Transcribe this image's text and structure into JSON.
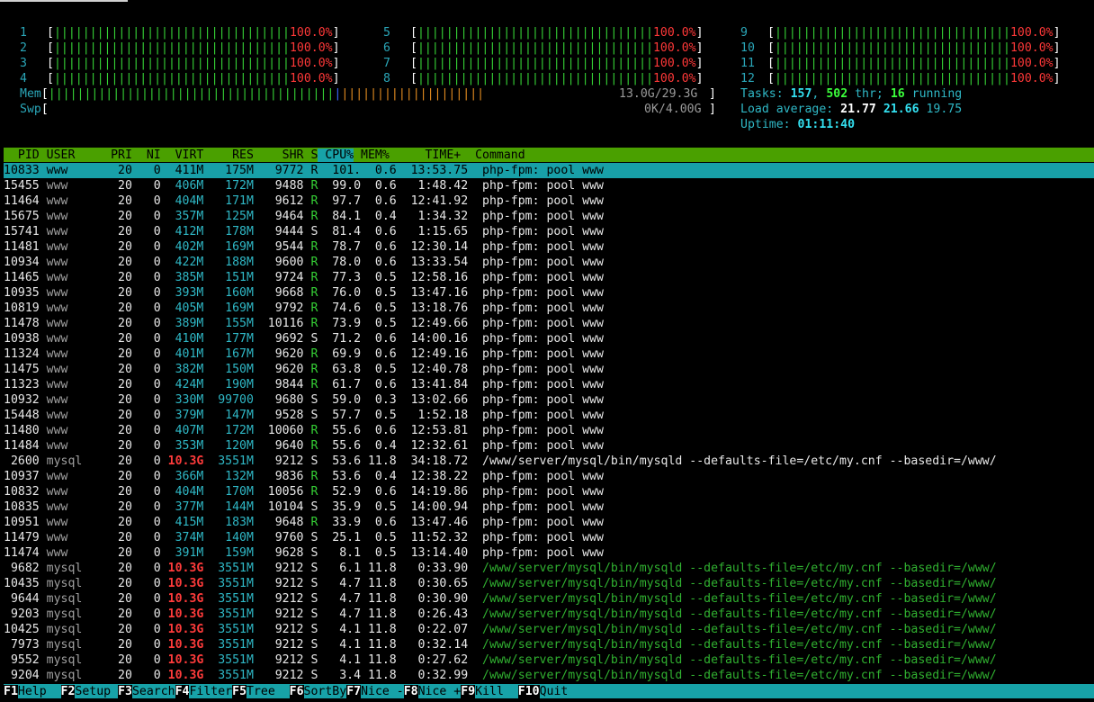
{
  "cpus": [
    {
      "id": "1",
      "pct": "100.0%"
    },
    {
      "id": "2",
      "pct": "100.0%"
    },
    {
      "id": "3",
      "pct": "100.0%"
    },
    {
      "id": "4",
      "pct": "100.0%"
    },
    {
      "id": "5",
      "pct": "100.0%"
    },
    {
      "id": "6",
      "pct": "100.0%"
    },
    {
      "id": "7",
      "pct": "100.0%"
    },
    {
      "id": "8",
      "pct": "100.0%"
    },
    {
      "id": "9",
      "pct": "100.0%"
    },
    {
      "id": "10",
      "pct": "100.0%"
    },
    {
      "id": "11",
      "pct": "100.0%"
    },
    {
      "id": "12",
      "pct": "100.0%"
    }
  ],
  "mem": {
    "label": "Mem",
    "value": "13.0G/29.3G"
  },
  "swp": {
    "label": "Swp",
    "value": "0K/4.00G"
  },
  "tasks": {
    "label": "Tasks:",
    "count": "157",
    "threads": "502",
    "thr_label": "thr;",
    "running": "16",
    "running_label": "running"
  },
  "load": {
    "label": "Load average:",
    "l1": "21.77",
    "l5": "21.66",
    "l15": "19.75"
  },
  "uptime": {
    "label": "Uptime:",
    "value": "01:11:40"
  },
  "columns": [
    "PID",
    "USER",
    "PRI",
    "NI",
    "VIRT",
    "RES",
    "SHR",
    "S",
    "CPU%",
    "MEM%",
    "TIME+",
    "Command"
  ],
  "processes": [
    {
      "pid": "10833",
      "user": "www",
      "pri": "20",
      "ni": "0",
      "virt": "411M",
      "res": "175M",
      "shr": "9772",
      "s": "R",
      "cpu": "101.",
      "mem": "0.6",
      "time": "13:53.75",
      "cmd": "php-fpm: pool www"
    },
    {
      "pid": "15455",
      "user": "www",
      "pri": "20",
      "ni": "0",
      "virt": "406M",
      "res": "172M",
      "shr": "9488",
      "s": "R",
      "cpu": "99.0",
      "mem": "0.6",
      "time": "1:48.42",
      "cmd": "php-fpm: pool www"
    },
    {
      "pid": "11464",
      "user": "www",
      "pri": "20",
      "ni": "0",
      "virt": "404M",
      "res": "171M",
      "shr": "9612",
      "s": "R",
      "cpu": "97.7",
      "mem": "0.6",
      "time": "12:41.92",
      "cmd": "php-fpm: pool www"
    },
    {
      "pid": "15675",
      "user": "www",
      "pri": "20",
      "ni": "0",
      "virt": "357M",
      "res": "125M",
      "shr": "9464",
      "s": "R",
      "cpu": "84.1",
      "mem": "0.4",
      "time": "1:34.32",
      "cmd": "php-fpm: pool www"
    },
    {
      "pid": "15741",
      "user": "www",
      "pri": "20",
      "ni": "0",
      "virt": "412M",
      "res": "178M",
      "shr": "9444",
      "s": "S",
      "cpu": "81.4",
      "mem": "0.6",
      "time": "1:15.65",
      "cmd": "php-fpm: pool www"
    },
    {
      "pid": "11481",
      "user": "www",
      "pri": "20",
      "ni": "0",
      "virt": "402M",
      "res": "169M",
      "shr": "9544",
      "s": "R",
      "cpu": "78.7",
      "mem": "0.6",
      "time": "12:30.14",
      "cmd": "php-fpm: pool www"
    },
    {
      "pid": "10934",
      "user": "www",
      "pri": "20",
      "ni": "0",
      "virt": "422M",
      "res": "188M",
      "shr": "9600",
      "s": "R",
      "cpu": "78.0",
      "mem": "0.6",
      "time": "13:33.54",
      "cmd": "php-fpm: pool www"
    },
    {
      "pid": "11465",
      "user": "www",
      "pri": "20",
      "ni": "0",
      "virt": "385M",
      "res": "151M",
      "shr": "9724",
      "s": "R",
      "cpu": "77.3",
      "mem": "0.5",
      "time": "12:58.16",
      "cmd": "php-fpm: pool www"
    },
    {
      "pid": "10935",
      "user": "www",
      "pri": "20",
      "ni": "0",
      "virt": "393M",
      "res": "160M",
      "shr": "9668",
      "s": "R",
      "cpu": "76.0",
      "mem": "0.5",
      "time": "13:47.16",
      "cmd": "php-fpm: pool www"
    },
    {
      "pid": "10819",
      "user": "www",
      "pri": "20",
      "ni": "0",
      "virt": "405M",
      "res": "169M",
      "shr": "9792",
      "s": "R",
      "cpu": "74.6",
      "mem": "0.5",
      "time": "13:18.76",
      "cmd": "php-fpm: pool www"
    },
    {
      "pid": "11478",
      "user": "www",
      "pri": "20",
      "ni": "0",
      "virt": "389M",
      "res": "155M",
      "shr": "10116",
      "s": "R",
      "cpu": "73.9",
      "mem": "0.5",
      "time": "12:49.66",
      "cmd": "php-fpm: pool www"
    },
    {
      "pid": "10938",
      "user": "www",
      "pri": "20",
      "ni": "0",
      "virt": "410M",
      "res": "177M",
      "shr": "9692",
      "s": "S",
      "cpu": "71.2",
      "mem": "0.6",
      "time": "14:00.16",
      "cmd": "php-fpm: pool www"
    },
    {
      "pid": "11324",
      "user": "www",
      "pri": "20",
      "ni": "0",
      "virt": "401M",
      "res": "167M",
      "shr": "9620",
      "s": "R",
      "cpu": "69.9",
      "mem": "0.6",
      "time": "12:49.16",
      "cmd": "php-fpm: pool www"
    },
    {
      "pid": "11475",
      "user": "www",
      "pri": "20",
      "ni": "0",
      "virt": "382M",
      "res": "150M",
      "shr": "9620",
      "s": "R",
      "cpu": "63.8",
      "mem": "0.5",
      "time": "12:40.78",
      "cmd": "php-fpm: pool www"
    },
    {
      "pid": "11323",
      "user": "www",
      "pri": "20",
      "ni": "0",
      "virt": "424M",
      "res": "190M",
      "shr": "9844",
      "s": "R",
      "cpu": "61.7",
      "mem": "0.6",
      "time": "13:41.84",
      "cmd": "php-fpm: pool www"
    },
    {
      "pid": "10932",
      "user": "www",
      "pri": "20",
      "ni": "0",
      "virt": "330M",
      "res": "99700",
      "shr": "9680",
      "s": "S",
      "cpu": "59.0",
      "mem": "0.3",
      "time": "13:02.66",
      "cmd": "php-fpm: pool www"
    },
    {
      "pid": "15448",
      "user": "www",
      "pri": "20",
      "ni": "0",
      "virt": "379M",
      "res": "147M",
      "shr": "9528",
      "s": "S",
      "cpu": "57.7",
      "mem": "0.5",
      "time": "1:52.18",
      "cmd": "php-fpm: pool www"
    },
    {
      "pid": "11480",
      "user": "www",
      "pri": "20",
      "ni": "0",
      "virt": "407M",
      "res": "172M",
      "shr": "10060",
      "s": "R",
      "cpu": "55.6",
      "mem": "0.6",
      "time": "12:53.81",
      "cmd": "php-fpm: pool www"
    },
    {
      "pid": "11484",
      "user": "www",
      "pri": "20",
      "ni": "0",
      "virt": "353M",
      "res": "120M",
      "shr": "9640",
      "s": "R",
      "cpu": "55.6",
      "mem": "0.4",
      "time": "12:32.61",
      "cmd": "php-fpm: pool www"
    },
    {
      "pid": "2600",
      "user": "mysql",
      "pri": "20",
      "ni": "0",
      "virt": "10.3G",
      "res": "3551M",
      "shr": "9212",
      "s": "S",
      "cpu": "53.6",
      "mem": "11.8",
      "time": "34:18.72",
      "cmd": "/www/server/mysql/bin/mysqld --defaults-file=/etc/my.cnf --basedir=/www/"
    },
    {
      "pid": "10937",
      "user": "www",
      "pri": "20",
      "ni": "0",
      "virt": "366M",
      "res": "132M",
      "shr": "9836",
      "s": "R",
      "cpu": "53.6",
      "mem": "0.4",
      "time": "12:38.22",
      "cmd": "php-fpm: pool www"
    },
    {
      "pid": "10832",
      "user": "www",
      "pri": "20",
      "ni": "0",
      "virt": "404M",
      "res": "170M",
      "shr": "10056",
      "s": "R",
      "cpu": "52.9",
      "mem": "0.6",
      "time": "14:19.86",
      "cmd": "php-fpm: pool www"
    },
    {
      "pid": "10835",
      "user": "www",
      "pri": "20",
      "ni": "0",
      "virt": "377M",
      "res": "144M",
      "shr": "10104",
      "s": "S",
      "cpu": "35.9",
      "mem": "0.5",
      "time": "14:00.94",
      "cmd": "php-fpm: pool www"
    },
    {
      "pid": "10951",
      "user": "www",
      "pri": "20",
      "ni": "0",
      "virt": "415M",
      "res": "183M",
      "shr": "9648",
      "s": "R",
      "cpu": "33.9",
      "mem": "0.6",
      "time": "13:47.46",
      "cmd": "php-fpm: pool www"
    },
    {
      "pid": "11479",
      "user": "www",
      "pri": "20",
      "ni": "0",
      "virt": "374M",
      "res": "140M",
      "shr": "9760",
      "s": "S",
      "cpu": "25.1",
      "mem": "0.5",
      "time": "11:52.32",
      "cmd": "php-fpm: pool www"
    },
    {
      "pid": "11474",
      "user": "www",
      "pri": "20",
      "ni": "0",
      "virt": "391M",
      "res": "159M",
      "shr": "9628",
      "s": "S",
      "cpu": "8.1",
      "mem": "0.5",
      "time": "13:14.40",
      "cmd": "php-fpm: pool www"
    },
    {
      "pid": "9682",
      "user": "mysql",
      "pri": "20",
      "ni": "0",
      "virt": "10.3G",
      "res": "3551M",
      "shr": "9212",
      "s": "S",
      "cpu": "6.1",
      "mem": "11.8",
      "time": "0:33.90",
      "cmd": "/www/server/mysql/bin/mysqld --defaults-file=/etc/my.cnf --basedir=/www/"
    },
    {
      "pid": "10435",
      "user": "mysql",
      "pri": "20",
      "ni": "0",
      "virt": "10.3G",
      "res": "3551M",
      "shr": "9212",
      "s": "S",
      "cpu": "4.7",
      "mem": "11.8",
      "time": "0:30.65",
      "cmd": "/www/server/mysql/bin/mysqld --defaults-file=/etc/my.cnf --basedir=/www/"
    },
    {
      "pid": "9644",
      "user": "mysql",
      "pri": "20",
      "ni": "0",
      "virt": "10.3G",
      "res": "3551M",
      "shr": "9212",
      "s": "S",
      "cpu": "4.7",
      "mem": "11.8",
      "time": "0:30.90",
      "cmd": "/www/server/mysql/bin/mysqld --defaults-file=/etc/my.cnf --basedir=/www/"
    },
    {
      "pid": "9203",
      "user": "mysql",
      "pri": "20",
      "ni": "0",
      "virt": "10.3G",
      "res": "3551M",
      "shr": "9212",
      "s": "S",
      "cpu": "4.7",
      "mem": "11.8",
      "time": "0:26.43",
      "cmd": "/www/server/mysql/bin/mysqld --defaults-file=/etc/my.cnf --basedir=/www/"
    },
    {
      "pid": "10425",
      "user": "mysql",
      "pri": "20",
      "ni": "0",
      "virt": "10.3G",
      "res": "3551M",
      "shr": "9212",
      "s": "S",
      "cpu": "4.1",
      "mem": "11.8",
      "time": "0:22.07",
      "cmd": "/www/server/mysql/bin/mysqld --defaults-file=/etc/my.cnf --basedir=/www/"
    },
    {
      "pid": "7973",
      "user": "mysql",
      "pri": "20",
      "ni": "0",
      "virt": "10.3G",
      "res": "3551M",
      "shr": "9212",
      "s": "S",
      "cpu": "4.1",
      "mem": "11.8",
      "time": "0:32.14",
      "cmd": "/www/server/mysql/bin/mysqld --defaults-file=/etc/my.cnf --basedir=/www/"
    },
    {
      "pid": "9552",
      "user": "mysql",
      "pri": "20",
      "ni": "0",
      "virt": "10.3G",
      "res": "3551M",
      "shr": "9212",
      "s": "S",
      "cpu": "4.1",
      "mem": "11.8",
      "time": "0:27.62",
      "cmd": "/www/server/mysql/bin/mysqld --defaults-file=/etc/my.cnf --basedir=/www/"
    },
    {
      "pid": "9204",
      "user": "mysql",
      "pri": "20",
      "ni": "0",
      "virt": "10.3G",
      "res": "3551M",
      "shr": "9212",
      "s": "S",
      "cpu": "3.4",
      "mem": "11.8",
      "time": "0:32.99",
      "cmd": "/www/server/mysql/bin/mysqld --defaults-file=/etc/my.cnf --basedir=/www/"
    }
  ],
  "footer": [
    {
      "key": "F1",
      "label": "Help  "
    },
    {
      "key": "F2",
      "label": "Setup "
    },
    {
      "key": "F3",
      "label": "Search"
    },
    {
      "key": "F4",
      "label": "Filter"
    },
    {
      "key": "F5",
      "label": "Tree  "
    },
    {
      "key": "F6",
      "label": "SortBy"
    },
    {
      "key": "F7",
      "label": "Nice -"
    },
    {
      "key": "F8",
      "label": "Nice +"
    },
    {
      "key": "F9",
      "label": "Kill  "
    },
    {
      "key": "F10",
      "label": "Quit"
    }
  ],
  "colors": {
    "header_bg": "#4aa000",
    "selected_bg": "#18a0a8",
    "footer_bg": "#17a2a8",
    "big_virt": "#ff3b3b"
  }
}
